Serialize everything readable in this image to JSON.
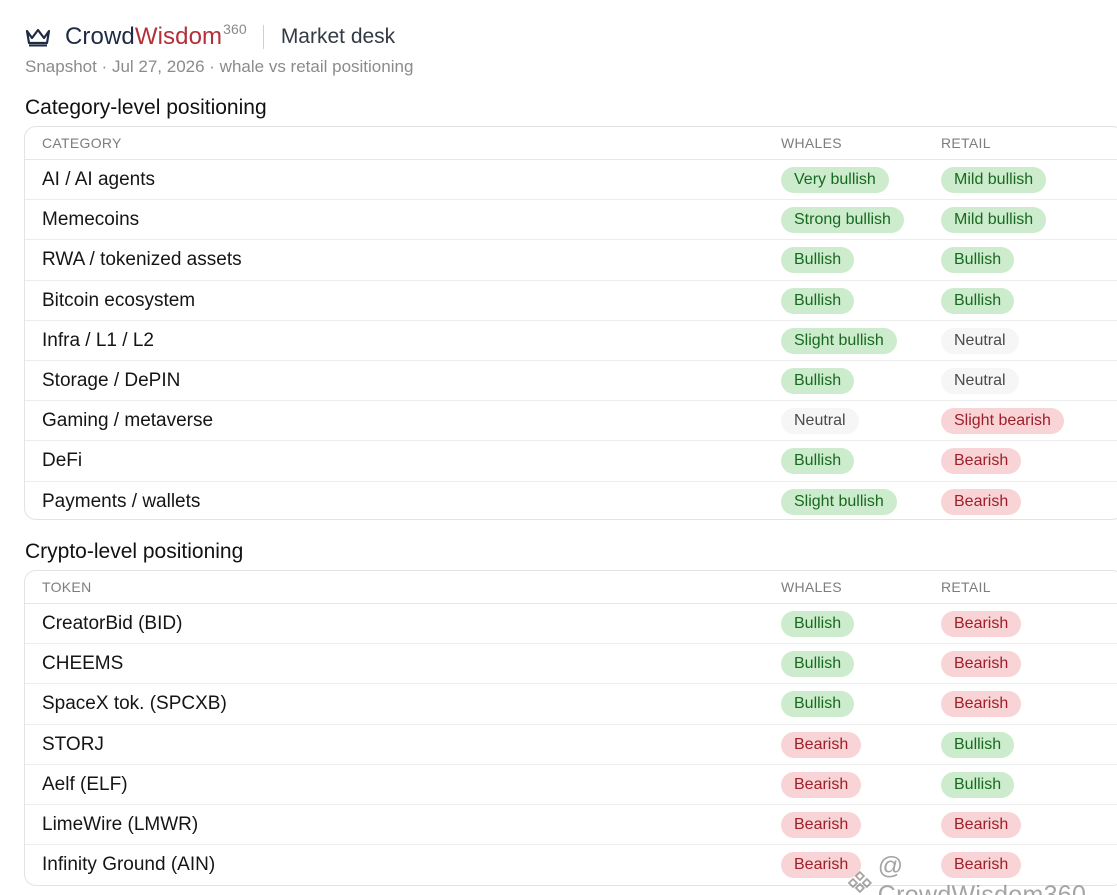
{
  "header": {
    "brand_part1": "Crowd",
    "brand_part2": "Wisdom",
    "brand_sup": "360",
    "desk": "Market desk",
    "subtitle": "Snapshot · Jul 27, 2026 · whale vs retail positioning",
    "icon": "crown-icon"
  },
  "colors": {
    "brand_dark": "#1f2b44",
    "brand_red": "#b3303a",
    "bullish_bg": "#cdeccd",
    "bullish_text": "#17691f",
    "bearish_bg": "#f8d4d6",
    "bearish_text": "#9e1f2a",
    "neutral_bg": "#f6f6f6"
  },
  "category_section": {
    "title": "Category-level positioning",
    "columns": [
      "CATEGORY",
      "WHALES",
      "RETAIL"
    ],
    "rows": [
      {
        "name": "AI / AI agents",
        "whales": "Very bullish",
        "whales_tone": "green",
        "retail": "Mild bullish",
        "retail_tone": "green"
      },
      {
        "name": "Memecoins",
        "whales": "Strong bullish",
        "whales_tone": "green",
        "retail": "Mild bullish",
        "retail_tone": "green"
      },
      {
        "name": "RWA / tokenized assets",
        "whales": "Bullish",
        "whales_tone": "green",
        "retail": "Bullish",
        "retail_tone": "green"
      },
      {
        "name": "Bitcoin ecosystem",
        "whales": "Bullish",
        "whales_tone": "green",
        "retail": "Bullish",
        "retail_tone": "green"
      },
      {
        "name": "Infra / L1 / L2",
        "whales": "Slight bullish",
        "whales_tone": "green",
        "retail": "Neutral",
        "retail_tone": "gray"
      },
      {
        "name": "Storage / DePIN",
        "whales": "Bullish",
        "whales_tone": "green",
        "retail": "Neutral",
        "retail_tone": "gray"
      },
      {
        "name": "Gaming / metaverse",
        "whales": "Neutral",
        "whales_tone": "gray",
        "retail": "Slight bearish",
        "retail_tone": "red"
      },
      {
        "name": "DeFi",
        "whales": "Bullish",
        "whales_tone": "green",
        "retail": "Bearish",
        "retail_tone": "red"
      },
      {
        "name": "Payments / wallets",
        "whales": "Slight bullish",
        "whales_tone": "green",
        "retail": "Bearish",
        "retail_tone": "red"
      }
    ]
  },
  "token_section": {
    "title": "Crypto-level positioning",
    "columns": [
      "TOKEN",
      "WHALES",
      "RETAIL"
    ],
    "rows": [
      {
        "name": "CreatorBid (BID)",
        "whales": "Bullish",
        "whales_tone": "green",
        "retail": "Bearish",
        "retail_tone": "red"
      },
      {
        "name": "CHEEMS",
        "whales": "Bullish",
        "whales_tone": "green",
        "retail": "Bearish",
        "retail_tone": "red"
      },
      {
        "name": "SpaceX tok. (SPCXB)",
        "whales": "Bullish",
        "whales_tone": "green",
        "retail": "Bearish",
        "retail_tone": "red"
      },
      {
        "name": "STORJ",
        "whales": "Bearish",
        "whales_tone": "red",
        "retail": "Bullish",
        "retail_tone": "green"
      },
      {
        "name": "Aelf (ELF)",
        "whales": "Bearish",
        "whales_tone": "red",
        "retail": "Bullish",
        "retail_tone": "green"
      },
      {
        "name": "LimeWire (LMWR)",
        "whales": "Bearish",
        "whales_tone": "red",
        "retail": "Bearish",
        "retail_tone": "red"
      },
      {
        "name": "Infinity Ground (AIN)",
        "whales": "Bearish",
        "whales_tone": "red",
        "retail": "Bearish",
        "retail_tone": "red"
      }
    ]
  },
  "watermark": {
    "text": "@ CrowdWisdom360",
    "icon": "watermark-logo-icon"
  }
}
